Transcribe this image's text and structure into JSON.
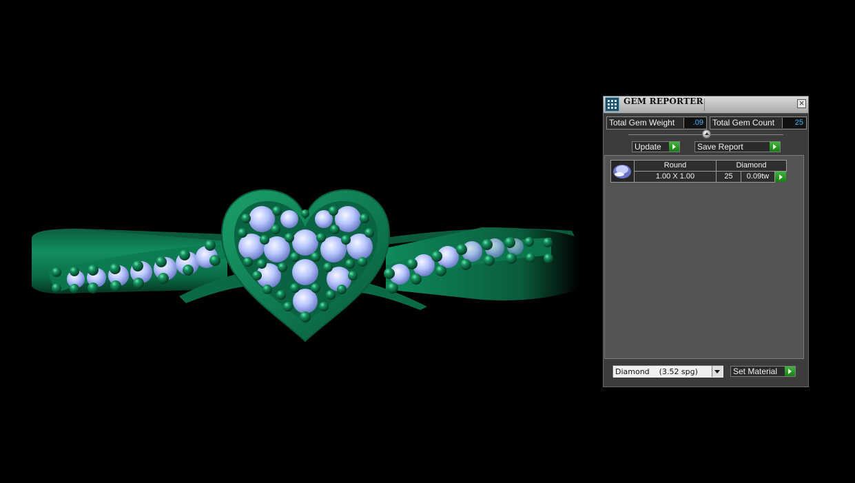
{
  "panel": {
    "title": "GEM REPORTER",
    "total_gem_weight_label": "Total Gem Weight",
    "total_gem_weight_value": ".09",
    "total_gem_count_label": "Total Gem Count",
    "total_gem_count_value": "25",
    "update_label": "Update",
    "save_report_label": "Save Report",
    "table": {
      "shape_header": "Round",
      "material_header": "Diamond",
      "size": "1.00 X 1.00",
      "count": "25",
      "weight": "0.09tw"
    },
    "material_select": "Diamond    (3.52 spg)",
    "set_material_label": "Set Material"
  },
  "colors": {
    "metal": "#0f8a5b",
    "gem": "#b9c6ff",
    "accent_green": "#2fa22b",
    "value_text": "#39b8ff"
  },
  "icons": [
    "gem-reporter-icon",
    "close-icon",
    "gem-thumbnail-icon",
    "arrow-right-icon",
    "chevron-down-icon"
  ]
}
